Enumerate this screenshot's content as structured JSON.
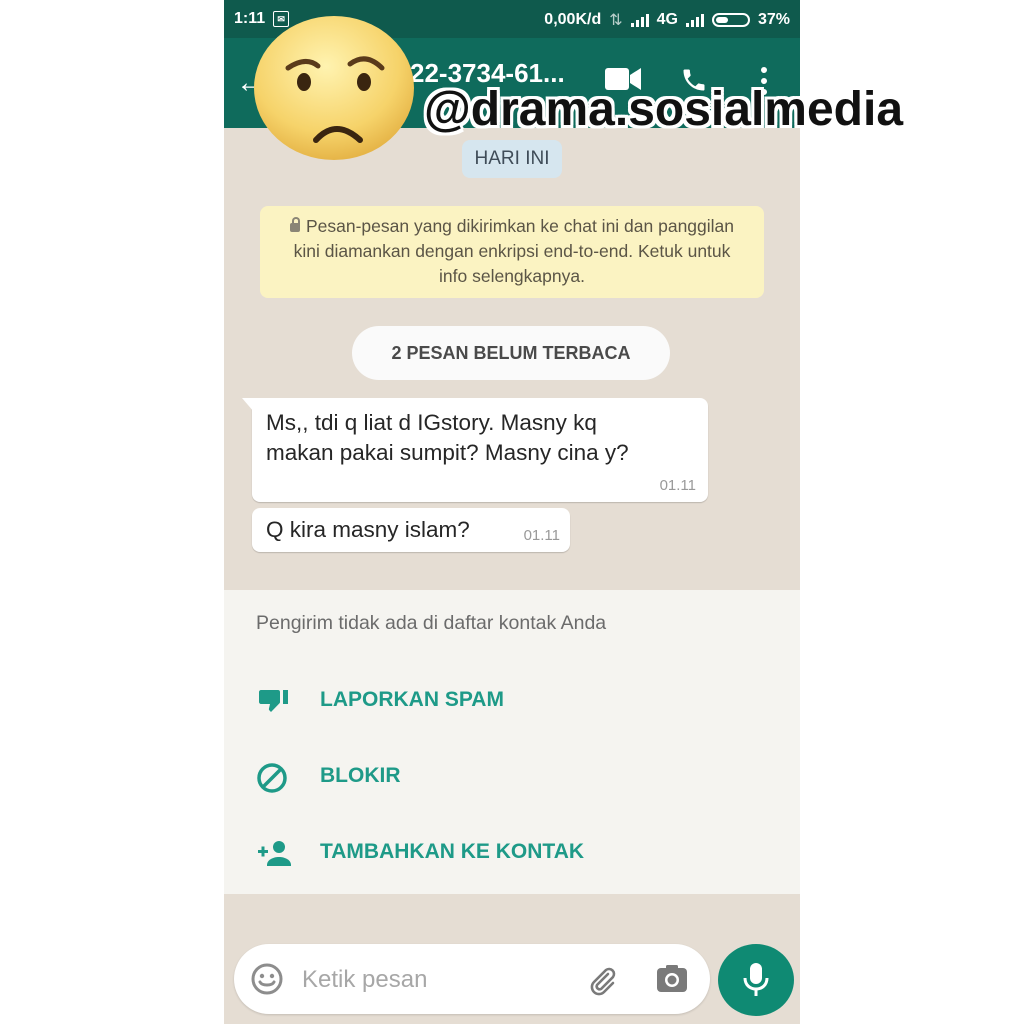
{
  "status_bar": {
    "time": "1:11",
    "net_speed": "0,00K/d",
    "network": "4G",
    "battery": "37%"
  },
  "chat_header": {
    "title": "22-3734-61..."
  },
  "chat": {
    "date_chip": "HARI INI",
    "encryption_notice": "Pesan-pesan yang dikirimkan ke chat ini dan panggilan kini diamankan dengan enkripsi end-to-end. Ketuk untuk info selengkapnya.",
    "unread_banner": "2 PESAN BELUM TERBACA",
    "messages": [
      {
        "lines": [
          "Ms,, tdi q liat d IGstory. Masny kq",
          "makan pakai sumpit? Masny cina y?"
        ],
        "time": "01.11"
      },
      {
        "lines": [
          "Q kira masny islam?"
        ],
        "time": "01.11"
      }
    ]
  },
  "unknown_sender_panel": {
    "note": "Pengirim tidak ada di daftar kontak Anda",
    "actions": [
      {
        "label": "LAPORKAN SPAM",
        "icon": "thumbs-down-icon"
      },
      {
        "label": "BLOKIR",
        "icon": "block-icon"
      },
      {
        "label": "TAMBAHKAN KE KONTAK",
        "icon": "add-contact-icon"
      }
    ]
  },
  "composer": {
    "placeholder": "Ketik pesan"
  },
  "overlay": {
    "watermark": "@drama.sosialmedia"
  },
  "colors": {
    "header": "#0f6b5c",
    "status_bar": "#0f5a4d",
    "accent": "#1e9a88",
    "chat_background": "#e5ddd3"
  }
}
